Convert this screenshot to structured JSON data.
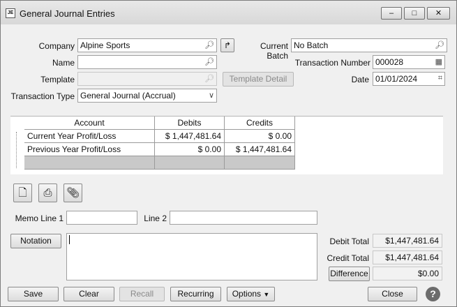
{
  "window": {
    "icon_text": "JE",
    "title": "General Journal Entries"
  },
  "form": {
    "company_label": "Company",
    "company_value": "Alpine Sports",
    "current_batch_label": "Current Batch",
    "current_batch_value": "No Batch",
    "name_label": "Name",
    "name_value": "",
    "transaction_number_label": "Transaction Number",
    "transaction_number_value": "000028",
    "template_label": "Template",
    "template_value": "",
    "template_detail_label": "Template Detail",
    "date_label": "Date",
    "date_value": "01/01/2024",
    "transaction_type_label": "Transaction Type",
    "transaction_type_value": "General Journal (Accrual)"
  },
  "grid": {
    "headers": [
      "Account",
      "Debits",
      "Credits"
    ],
    "rows": [
      {
        "account": "Current Year Profit/Loss",
        "debits": "$ 1,447,481.64",
        "credits": "$ 0.00"
      },
      {
        "account": "Previous Year Profit/Loss",
        "debits": "$ 0.00",
        "credits": "$ 1,447,481.64"
      }
    ]
  },
  "memo": {
    "line1_label": "Memo Line 1",
    "line1_value": "",
    "line2_label": "Line 2",
    "line2_value": ""
  },
  "notation": {
    "button_label": "Notation",
    "text": ""
  },
  "totals": {
    "debit_label": "Debit Total",
    "debit_value": "$1,447,481.64",
    "credit_label": "Credit Total",
    "credit_value": "$1,447,481.64",
    "difference_label": "Difference",
    "difference_value": "$0.00"
  },
  "buttons": {
    "save": "Save",
    "clear": "Clear",
    "recall": "Recall",
    "recurring": "Recurring",
    "options": "Options",
    "close": "Close",
    "help": "?"
  },
  "icons": [
    "delete-row-icon",
    "print-icon",
    "attachment-icon",
    "search-icon",
    "calendar-icon",
    "redo-icon"
  ]
}
